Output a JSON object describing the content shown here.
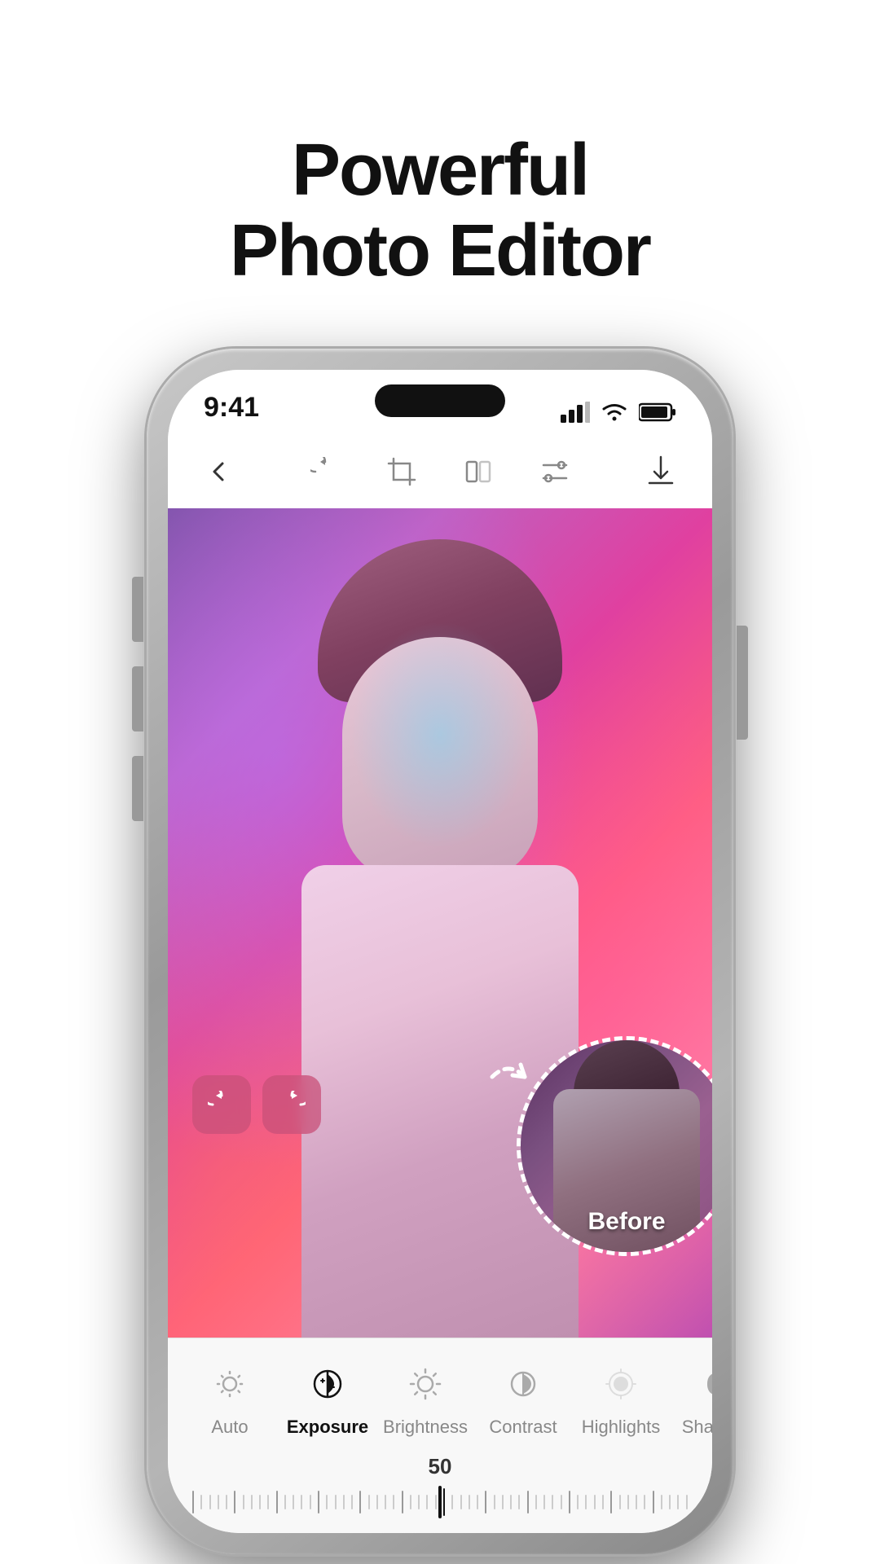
{
  "headline": {
    "line1": "Powerful",
    "line2": "Photo Editor"
  },
  "status_bar": {
    "time": "9:41"
  },
  "toolbar": {
    "back_label": "back",
    "rotate_label": "rotate",
    "crop_label": "crop",
    "flip_label": "flip",
    "adjust_label": "adjust",
    "download_label": "download"
  },
  "before_circle": {
    "label": "Before"
  },
  "bottom_panel": {
    "slider_value": "50",
    "tools": [
      {
        "id": "auto",
        "label": "Auto",
        "active": false
      },
      {
        "id": "exposure",
        "label": "Exposure",
        "active": true
      },
      {
        "id": "brightness",
        "label": "Brightness",
        "active": false
      },
      {
        "id": "contrast",
        "label": "Contrast",
        "active": false
      },
      {
        "id": "highlights",
        "label": "Highlights",
        "active": false
      },
      {
        "id": "shadows",
        "label": "Shadows",
        "active": false
      }
    ]
  },
  "colors": {
    "accent": "#e84080",
    "active_tool": "#111111",
    "inactive_tool": "#888888"
  }
}
